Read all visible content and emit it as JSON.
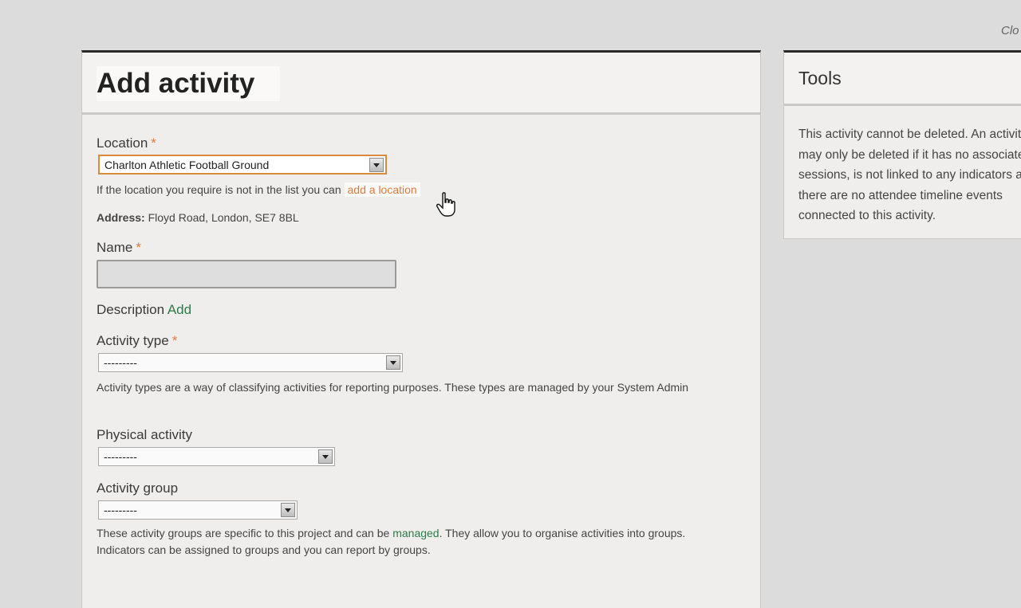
{
  "top_right": {
    "close_label": "Clo"
  },
  "main": {
    "title": "Add activity",
    "location": {
      "label": "Location",
      "required": "*",
      "selected": "Charlton Athletic Football Ground",
      "help_prefix": "If the location you require is not in the list you can ",
      "help_link": "add a location",
      "address_label": "Address:",
      "address_value": "Floyd Road, London, SE7 8BL"
    },
    "name": {
      "label": "Name",
      "required": "*",
      "value": ""
    },
    "description": {
      "label": "Description",
      "add_link": "Add"
    },
    "activity_type": {
      "label": "Activity type",
      "required": "*",
      "selected": "---------",
      "help": "Activity types are a way of classifying activities for reporting purposes. These types are managed by your System Admin"
    },
    "physical_activity": {
      "label": "Physical activity",
      "selected": "---------"
    },
    "activity_group": {
      "label": "Activity group",
      "selected": "---------",
      "help_prefix": "These activity groups are specific to this project and can be ",
      "help_link": "managed",
      "help_suffix": ". They allow you to organise activities into groups. Indicators can be assigned to groups and you can report by groups."
    }
  },
  "tools": {
    "title": "Tools",
    "message": "This activity cannot be deleted. An activity may only be deleted if it has no associated sessions, is not linked to any indicators and there are no attendee timeline events connected to this activity."
  },
  "colors": {
    "accent_orange": "#e07a3c",
    "link_green": "#2f7a4b",
    "panel_top_border": "#2b2b2b"
  }
}
